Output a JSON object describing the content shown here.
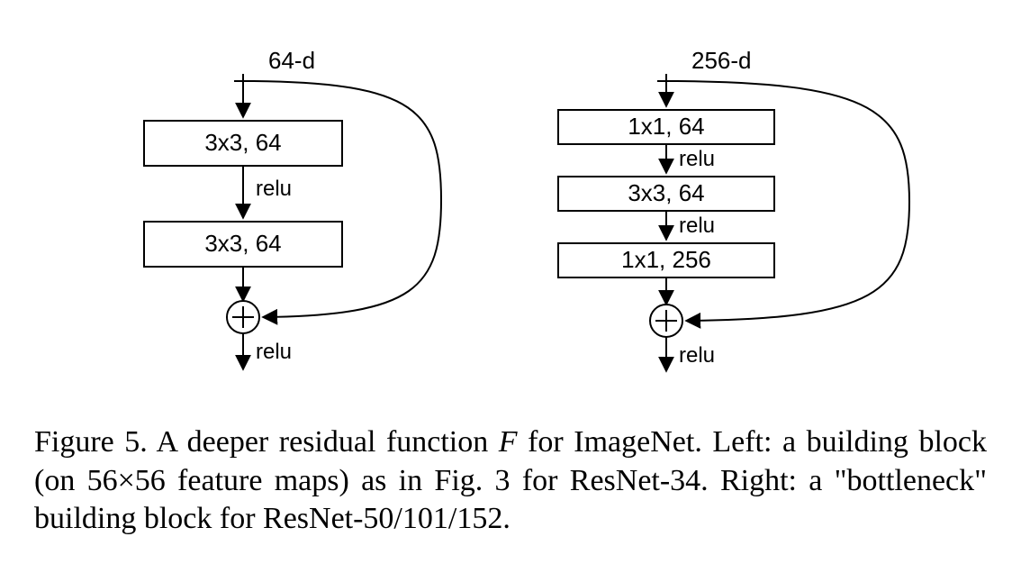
{
  "left": {
    "input_label": "64-d",
    "layers": [
      {
        "text": "3x3, 64",
        "after": "relu"
      },
      {
        "text": "3x3, 64",
        "after": null
      }
    ],
    "plus_after": "relu"
  },
  "right": {
    "input_label": "256-d",
    "layers": [
      {
        "text": "1x1, 64",
        "after": "relu"
      },
      {
        "text": "3x3, 64",
        "after": "relu"
      },
      {
        "text": "1x1, 256",
        "after": null
      }
    ],
    "plus_after": "relu"
  },
  "caption": {
    "pre": "Figure 5. A deeper residual function ",
    "F": "F",
    "post": " for ImageNet.  Left: a building block (on 56×56 feature maps) as in Fig. 3 for ResNet-34. Right: a \"bottleneck\" building block for ResNet-50/101/152."
  }
}
